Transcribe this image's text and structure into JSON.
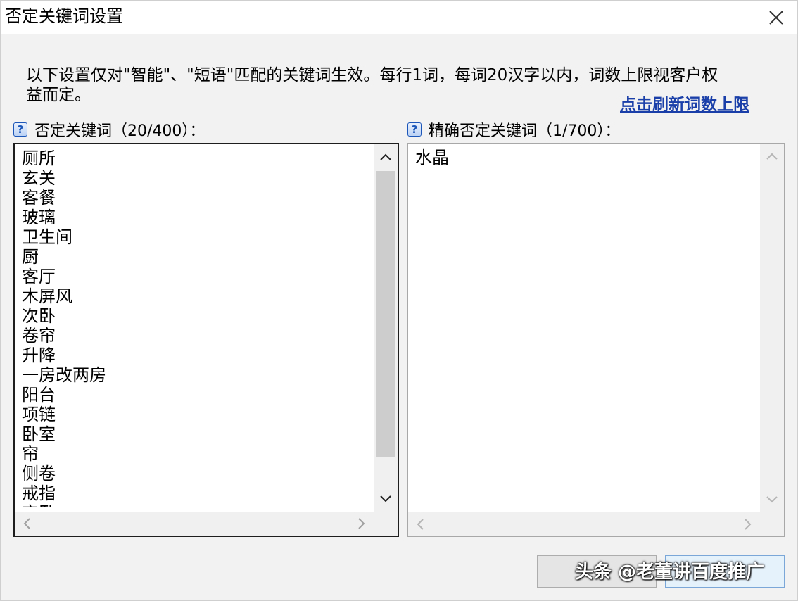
{
  "dialog": {
    "title": "否定关键词设置",
    "notice": "以下设置仅对\"智能\"、\"短语\"匹配的关键词生效。每行1词，每词20汉字以内，词数上限视客户权益而定。",
    "refresh_link": "点击刷新词数上限"
  },
  "negative_panel": {
    "label": "否定关键词（20/400）：",
    "items": [
      "厕所",
      "玄关",
      "客餐",
      "玻璃",
      "卫生间",
      "厨",
      "客厅",
      "木屏风",
      "次卧",
      "卷帘",
      "升降",
      "一房改两房",
      "阳台",
      "项链",
      "卧室",
      "帘",
      "侧卷",
      "戒指",
      "宝卧"
    ]
  },
  "exact_panel": {
    "label": "精确否定关键词（1/700）：",
    "items": [
      "水晶"
    ]
  },
  "footer": {
    "ok_label": "",
    "cancel_label": ""
  },
  "watermark": "头条 @老董讲百度推广",
  "colors": {
    "link": "#1a3fa8",
    "help_icon": "#1b56b8",
    "cancel_border": "#7aa7d8"
  },
  "icons": {
    "help": "help-icon",
    "close": "close-icon"
  }
}
